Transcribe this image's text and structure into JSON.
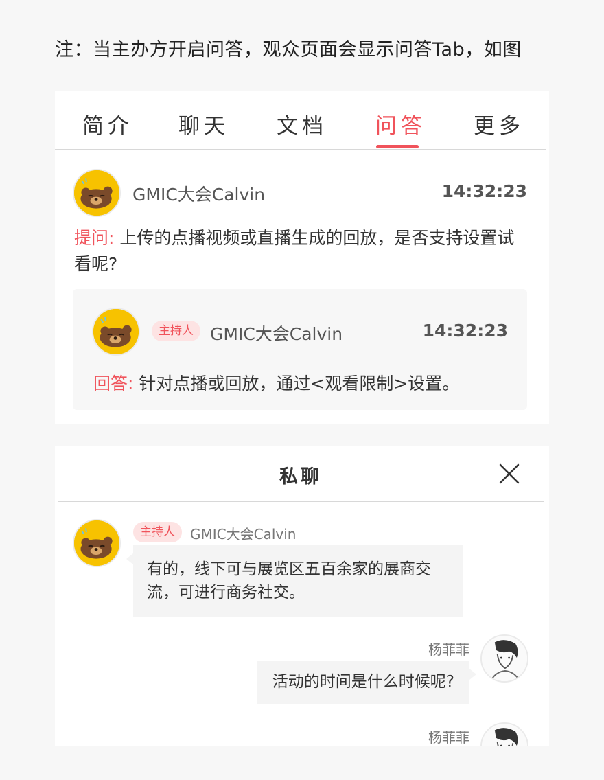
{
  "note": "注：当主办方开启问答，观众页面会显示问答Tab，如图",
  "tabs": [
    {
      "label": "简介"
    },
    {
      "label": "聊天"
    },
    {
      "label": "文档"
    },
    {
      "label": "问答"
    },
    {
      "label": "更多"
    }
  ],
  "question": {
    "user": "GMIC大会Calvin",
    "time": "14:32:23",
    "prefix": "提问:",
    "text": "上传的点播视频或直播生成的回放，是否支持设置试看呢?"
  },
  "answer": {
    "tag": "主持人",
    "user": "GMIC大会Calvin",
    "time": "14:32:23",
    "prefix": "回答:",
    "text": "针对点播或回放，通过<观看限制>设置。"
  },
  "private_chat": {
    "title": "私聊",
    "messages": [
      {
        "tag": "主持人",
        "user": "GMIC大会Calvin",
        "text": "有的，线下可与展览区五百余家的展商交流，可进行商务社交。"
      },
      {
        "user": "杨菲菲",
        "text": "活动的时间是什么时候呢?"
      },
      {
        "user": "杨菲菲"
      }
    ]
  },
  "colors": {
    "accent": "#f0535b",
    "avatar_bg": "#f7c200",
    "bubble": "#f4f4f4"
  }
}
